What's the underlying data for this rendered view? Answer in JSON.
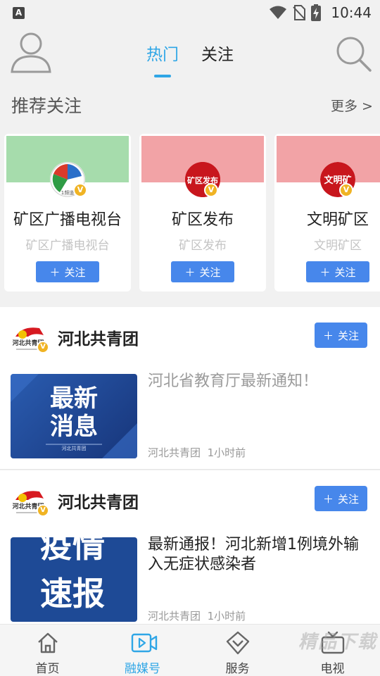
{
  "status_bar": {
    "app_icon_letter": "A",
    "time": "10:44"
  },
  "header": {
    "tabs": [
      {
        "label": "热门"
      },
      {
        "label": "关注"
      }
    ]
  },
  "recommend": {
    "title": "推荐关注",
    "more": "更多 >",
    "cards": [
      {
        "name": "矿区广播电视台",
        "subtitle": "矿区广播电视台",
        "follow": "关注",
        "banner_color": "#a6dcac",
        "logo_text": "1频道"
      },
      {
        "name": "矿区发布",
        "subtitle": "矿区发布",
        "follow": "关注",
        "banner_color": "#f2a3a6",
        "logo_text": "矿区发布"
      },
      {
        "name": "文明矿区",
        "subtitle": "文明矿区",
        "follow": "关注",
        "banner_color": "#f2a3a6",
        "logo_text": "文明矿"
      }
    ],
    "verified_badge": "V"
  },
  "feed": [
    {
      "publisher": "河北共青团",
      "publisher_logo_text": "河北共青团",
      "follow": "关注",
      "headline": "河北省教育厅最新通知！",
      "thumb_line1": "最新",
      "thumb_line2": "消息",
      "thumb_caption": "河北共青团",
      "source": "河北共青团",
      "time": "1小时前"
    },
    {
      "publisher": "河北共青团",
      "publisher_logo_text": "河北共青团",
      "follow": "关注",
      "headline": "最新通报！河北新增1例境外输入无症状感染者",
      "thumb_line1": "疫情",
      "thumb_line2": "速报",
      "source": "河北共青团",
      "time": "1小时前"
    }
  ],
  "bottom_nav": [
    {
      "label": "首页",
      "icon": "home-icon"
    },
    {
      "label": "融媒号",
      "icon": "video-icon"
    },
    {
      "label": "服务",
      "icon": "service-icon"
    },
    {
      "label": "电视",
      "icon": "tv-icon"
    }
  ],
  "watermark": "精品下载",
  "colors": {
    "accent": "#2fa6e6",
    "button": "#4787eb",
    "badge": "#f0b323",
    "thumb_bg": "#1e4a96"
  }
}
